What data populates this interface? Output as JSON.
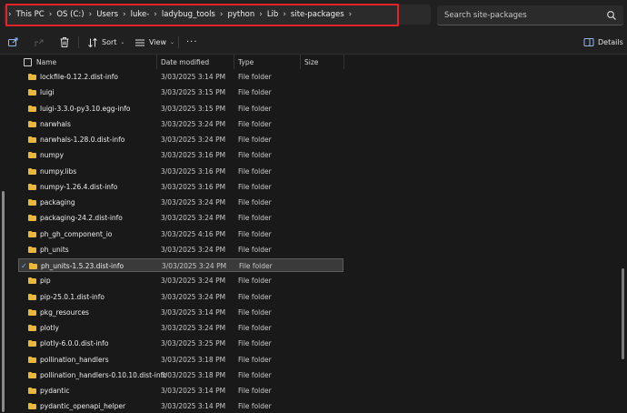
{
  "address_bar": {
    "path": [
      "This PC",
      "OS (C:)",
      "Users",
      "luke-",
      "ladybug_tools",
      "python",
      "Lib",
      "site-packages"
    ]
  },
  "search": {
    "placeholder": "Search site-packages",
    "icon": "search-icon"
  },
  "toolbar": {
    "sort_label": "Sort",
    "view_label": "View",
    "more_label": "···",
    "details_label": "Details"
  },
  "columns": {
    "name": "Name",
    "date": "Date modified",
    "type": "Type",
    "size": "Size"
  },
  "files": [
    {
      "name": "lockfile-0.12.2.dist-info",
      "date": "3/03/2025 3:14 PM",
      "type": "File folder"
    },
    {
      "name": "luigi",
      "date": "3/03/2025 3:15 PM",
      "type": "File folder"
    },
    {
      "name": "luigi-3.3.0-py3.10.egg-info",
      "date": "3/03/2025 3:15 PM",
      "type": "File folder"
    },
    {
      "name": "narwhals",
      "date": "3/03/2025 3:24 PM",
      "type": "File folder"
    },
    {
      "name": "narwhals-1.28.0.dist-info",
      "date": "3/03/2025 3:24 PM",
      "type": "File folder"
    },
    {
      "name": "numpy",
      "date": "3/03/2025 3:16 PM",
      "type": "File folder"
    },
    {
      "name": "numpy.libs",
      "date": "3/03/2025 3:16 PM",
      "type": "File folder"
    },
    {
      "name": "numpy-1.26.4.dist-info",
      "date": "3/03/2025 3:16 PM",
      "type": "File folder"
    },
    {
      "name": "packaging",
      "date": "3/03/2025 3:24 PM",
      "type": "File folder"
    },
    {
      "name": "packaging-24.2.dist-info",
      "date": "3/03/2025 3:24 PM",
      "type": "File folder"
    },
    {
      "name": "ph_gh_component_io",
      "date": "3/03/2025 4:16 PM",
      "type": "File folder"
    },
    {
      "name": "ph_units",
      "date": "3/03/2025 3:24 PM",
      "type": "File folder"
    },
    {
      "name": "ph_units-1.5.23.dist-info",
      "date": "3/03/2025 3:24 PM",
      "type": "File folder",
      "selected": true
    },
    {
      "name": "pip",
      "date": "3/03/2025 3:24 PM",
      "type": "File folder"
    },
    {
      "name": "pip-25.0.1.dist-info",
      "date": "3/03/2025 3:24 PM",
      "type": "File folder"
    },
    {
      "name": "pkg_resources",
      "date": "3/03/2025 3:14 PM",
      "type": "File folder"
    },
    {
      "name": "plotly",
      "date": "3/03/2025 3:24 PM",
      "type": "File folder"
    },
    {
      "name": "plotly-6.0.0.dist-info",
      "date": "3/03/2025 3:25 PM",
      "type": "File folder"
    },
    {
      "name": "pollination_handlers",
      "date": "3/03/2025 3:18 PM",
      "type": "File folder"
    },
    {
      "name": "pollination_handlers-0.10.10.dist-info",
      "date": "3/03/2025 3:18 PM",
      "type": "File folder"
    },
    {
      "name": "pydantic",
      "date": "3/03/2025 3:14 PM",
      "type": "File folder"
    },
    {
      "name": "pydantic_openapi_helper",
      "date": "3/03/2025 3:14 PM",
      "type": "File folder"
    }
  ],
  "colors": {
    "background": "#191919",
    "highlight_border": "#e0242a",
    "folder": "#e8b73c",
    "selected_row": "#3a3a3a"
  }
}
